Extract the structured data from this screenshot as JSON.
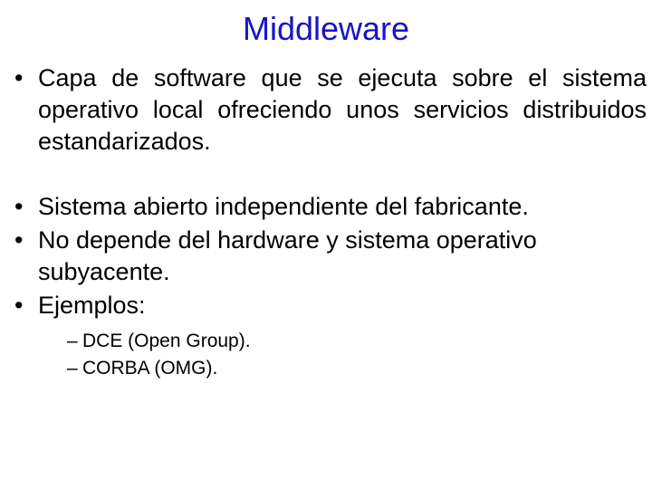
{
  "slide": {
    "title": "Middleware",
    "title_color": "#1414cc",
    "background_color": "#ffffff",
    "text_color": "#000000",
    "bullet_marker": "•",
    "subbullet_marker": "–",
    "bullets": [
      {
        "text": "Capa de software que se ejecuta sobre el sistema operativo local ofreciendo unos servicios distribuidos estandarizados.",
        "justified": true
      },
      {
        "text": "Sistema abierto independiente del fabricante.",
        "justified": false
      },
      {
        "text": "No depende del hardware y sistema operativo subyacente.",
        "justified": false
      },
      {
        "text": "Ejemplos:",
        "justified": false
      }
    ],
    "subbullets": [
      {
        "text": "DCE (Open Group)."
      },
      {
        "text": "CORBA (OMG)."
      }
    ]
  }
}
